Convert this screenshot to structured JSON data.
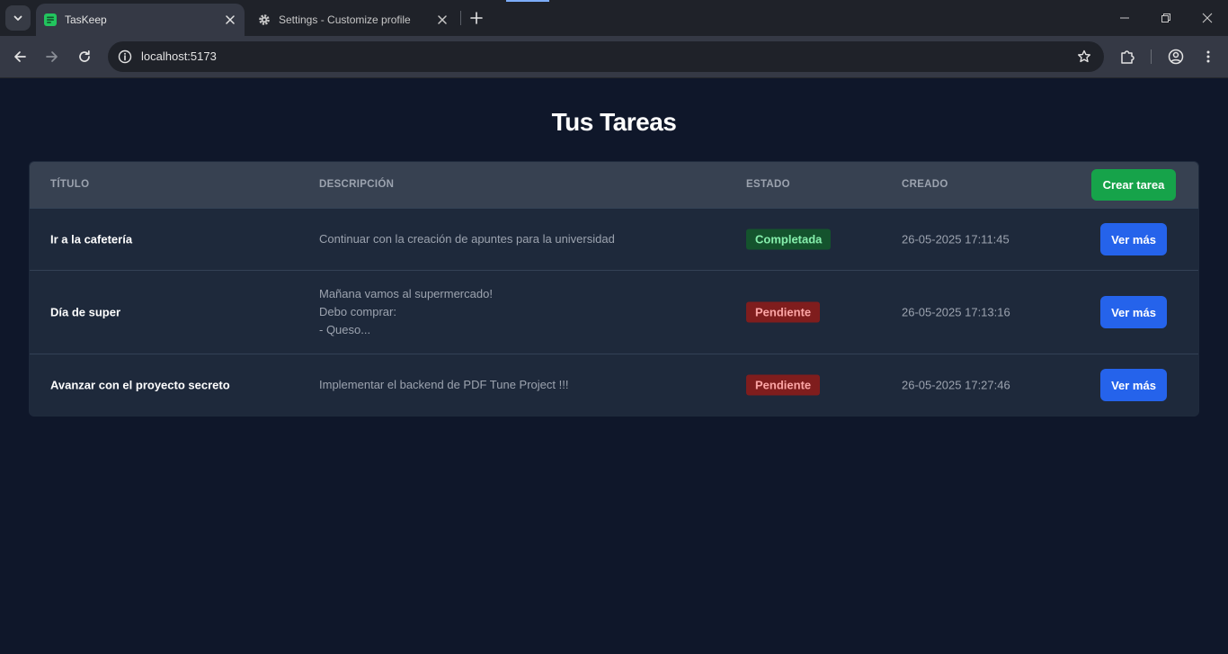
{
  "browser": {
    "tabs": [
      {
        "title": "TasKeep",
        "active": true,
        "icon": "taskeep-favicon"
      },
      {
        "title": "Settings - Customize profile",
        "active": false,
        "icon": "gear-icon"
      }
    ],
    "url": "localhost:5173"
  },
  "page": {
    "title": "Tus Tareas",
    "columns": {
      "title": "TÍTULO",
      "description": "DESCRIPCIÓN",
      "status": "ESTADO",
      "created": "CREADO"
    },
    "create_button": "Crear tarea",
    "view_more_label": "Ver más",
    "tasks": [
      {
        "title": "Ir a la cafetería",
        "description": "Continuar con la creación de apuntes para la universidad",
        "status": "Completada",
        "status_kind": "done",
        "created": "26-05-2025 17:11:45"
      },
      {
        "title": "Día de super",
        "description": "Mañana vamos al supermercado!\nDebo comprar:\n- Queso...",
        "status": "Pendiente",
        "status_kind": "pending",
        "created": "26-05-2025 17:13:16"
      },
      {
        "title": "Avanzar con el proyecto secreto",
        "description": "Implementar el backend de PDF Tune Project !!!",
        "status": "Pendiente",
        "status_kind": "pending",
        "created": "26-05-2025 17:27:46"
      }
    ]
  },
  "colors": {
    "page_bg": "#0f172a",
    "table_bg": "#1e293b",
    "header_bg": "#374151",
    "create_button": "#16a34a",
    "view_more_button": "#2563eb"
  }
}
